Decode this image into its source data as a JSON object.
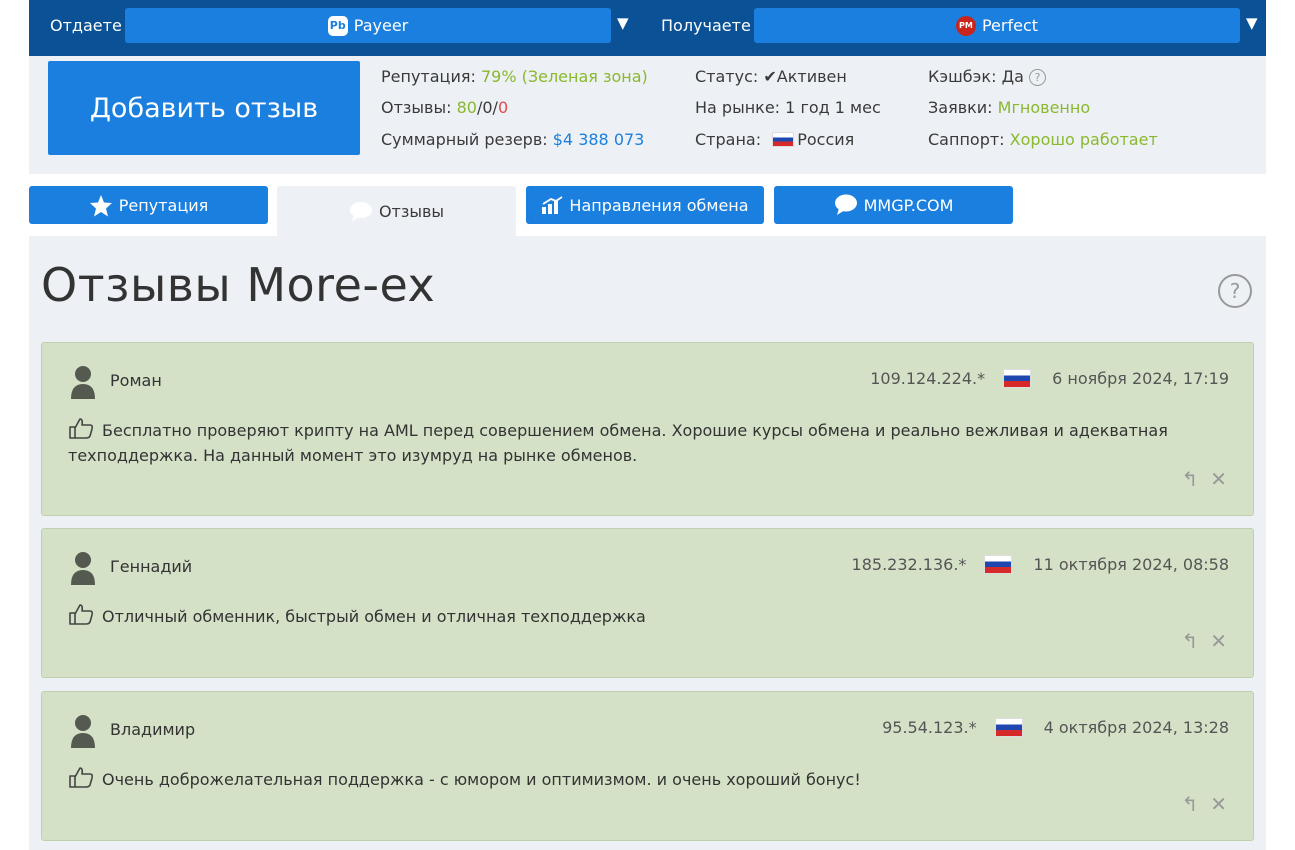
{
  "exchange": {
    "give_label": "Отдаете",
    "give_currency": "Payeer",
    "give_icon": "payeer-icon",
    "give_icon_text": "Pb",
    "get_label": "Получаете",
    "get_currency": "Perfect",
    "get_icon": "perfect-money-icon",
    "get_icon_text": "PM",
    "dropdown_arrow": "▼"
  },
  "info": {
    "add_review_button": "Добавить отзыв",
    "reputation_label": "Репутация:",
    "reputation_value": "79% (Зеленая зона)",
    "reviews_label": "Отзывы:",
    "reviews_positive": "80",
    "reviews_neutral": "0",
    "reviews_negative": "0",
    "reserve_label": "Суммарный резерв:",
    "reserve_value": "$4 388 073",
    "status_label": "Статус:",
    "status_value": "✔Активен",
    "market_label": "На рынке:",
    "market_value": "1 год 1 мес",
    "country_label": "Страна:",
    "country_value": "Россия",
    "cashback_label": "Кэшбэк:",
    "cashback_value": "Да",
    "orders_label": "Заявки:",
    "orders_value": "Мгновенно",
    "support_label": "Саппорт:",
    "support_value": "Хорошо работает"
  },
  "tabs": [
    {
      "label": "Репутация",
      "icon": "star-icon"
    },
    {
      "label": "Отзывы",
      "icon": "speech-bubble-icon"
    },
    {
      "label": "Направления обмена",
      "icon": "bar-chart-icon"
    },
    {
      "label": "MMGP.COM",
      "icon": "speech-bubble-icon"
    }
  ],
  "page": {
    "title": "Отзывы More-ex",
    "help": "?"
  },
  "reviews": [
    {
      "name": "Роман",
      "ip": "109.124.224.*",
      "date": "6 ноября 2024, 17:19",
      "text": "Бесплатно проверяют крипту на AML перед совершением обмена. Хорошие курсы обмена и реально вежливая и адекватная техподдержка. На данный момент это изумруд на рынке обменов."
    },
    {
      "name": "Геннадий",
      "ip": "185.232.136.*",
      "date": "11 октября 2024, 08:58",
      "text": "Отличный обменник, быстрый обмен и отличная техподдержка"
    },
    {
      "name": "Владимир",
      "ip": "95.54.123.*",
      "date": "4 октября 2024, 13:28",
      "text": "Очень доброжелательная поддержка - с юмором и оптимизмом. и очень хороший бонус!"
    }
  ],
  "colors": {
    "topbar": "#0b5196",
    "accent": "#1a7fde",
    "panel": "#edf1f5",
    "review_bg": "#d4e1c7",
    "positive": "#8ab82e",
    "negative": "#e14b4b"
  }
}
